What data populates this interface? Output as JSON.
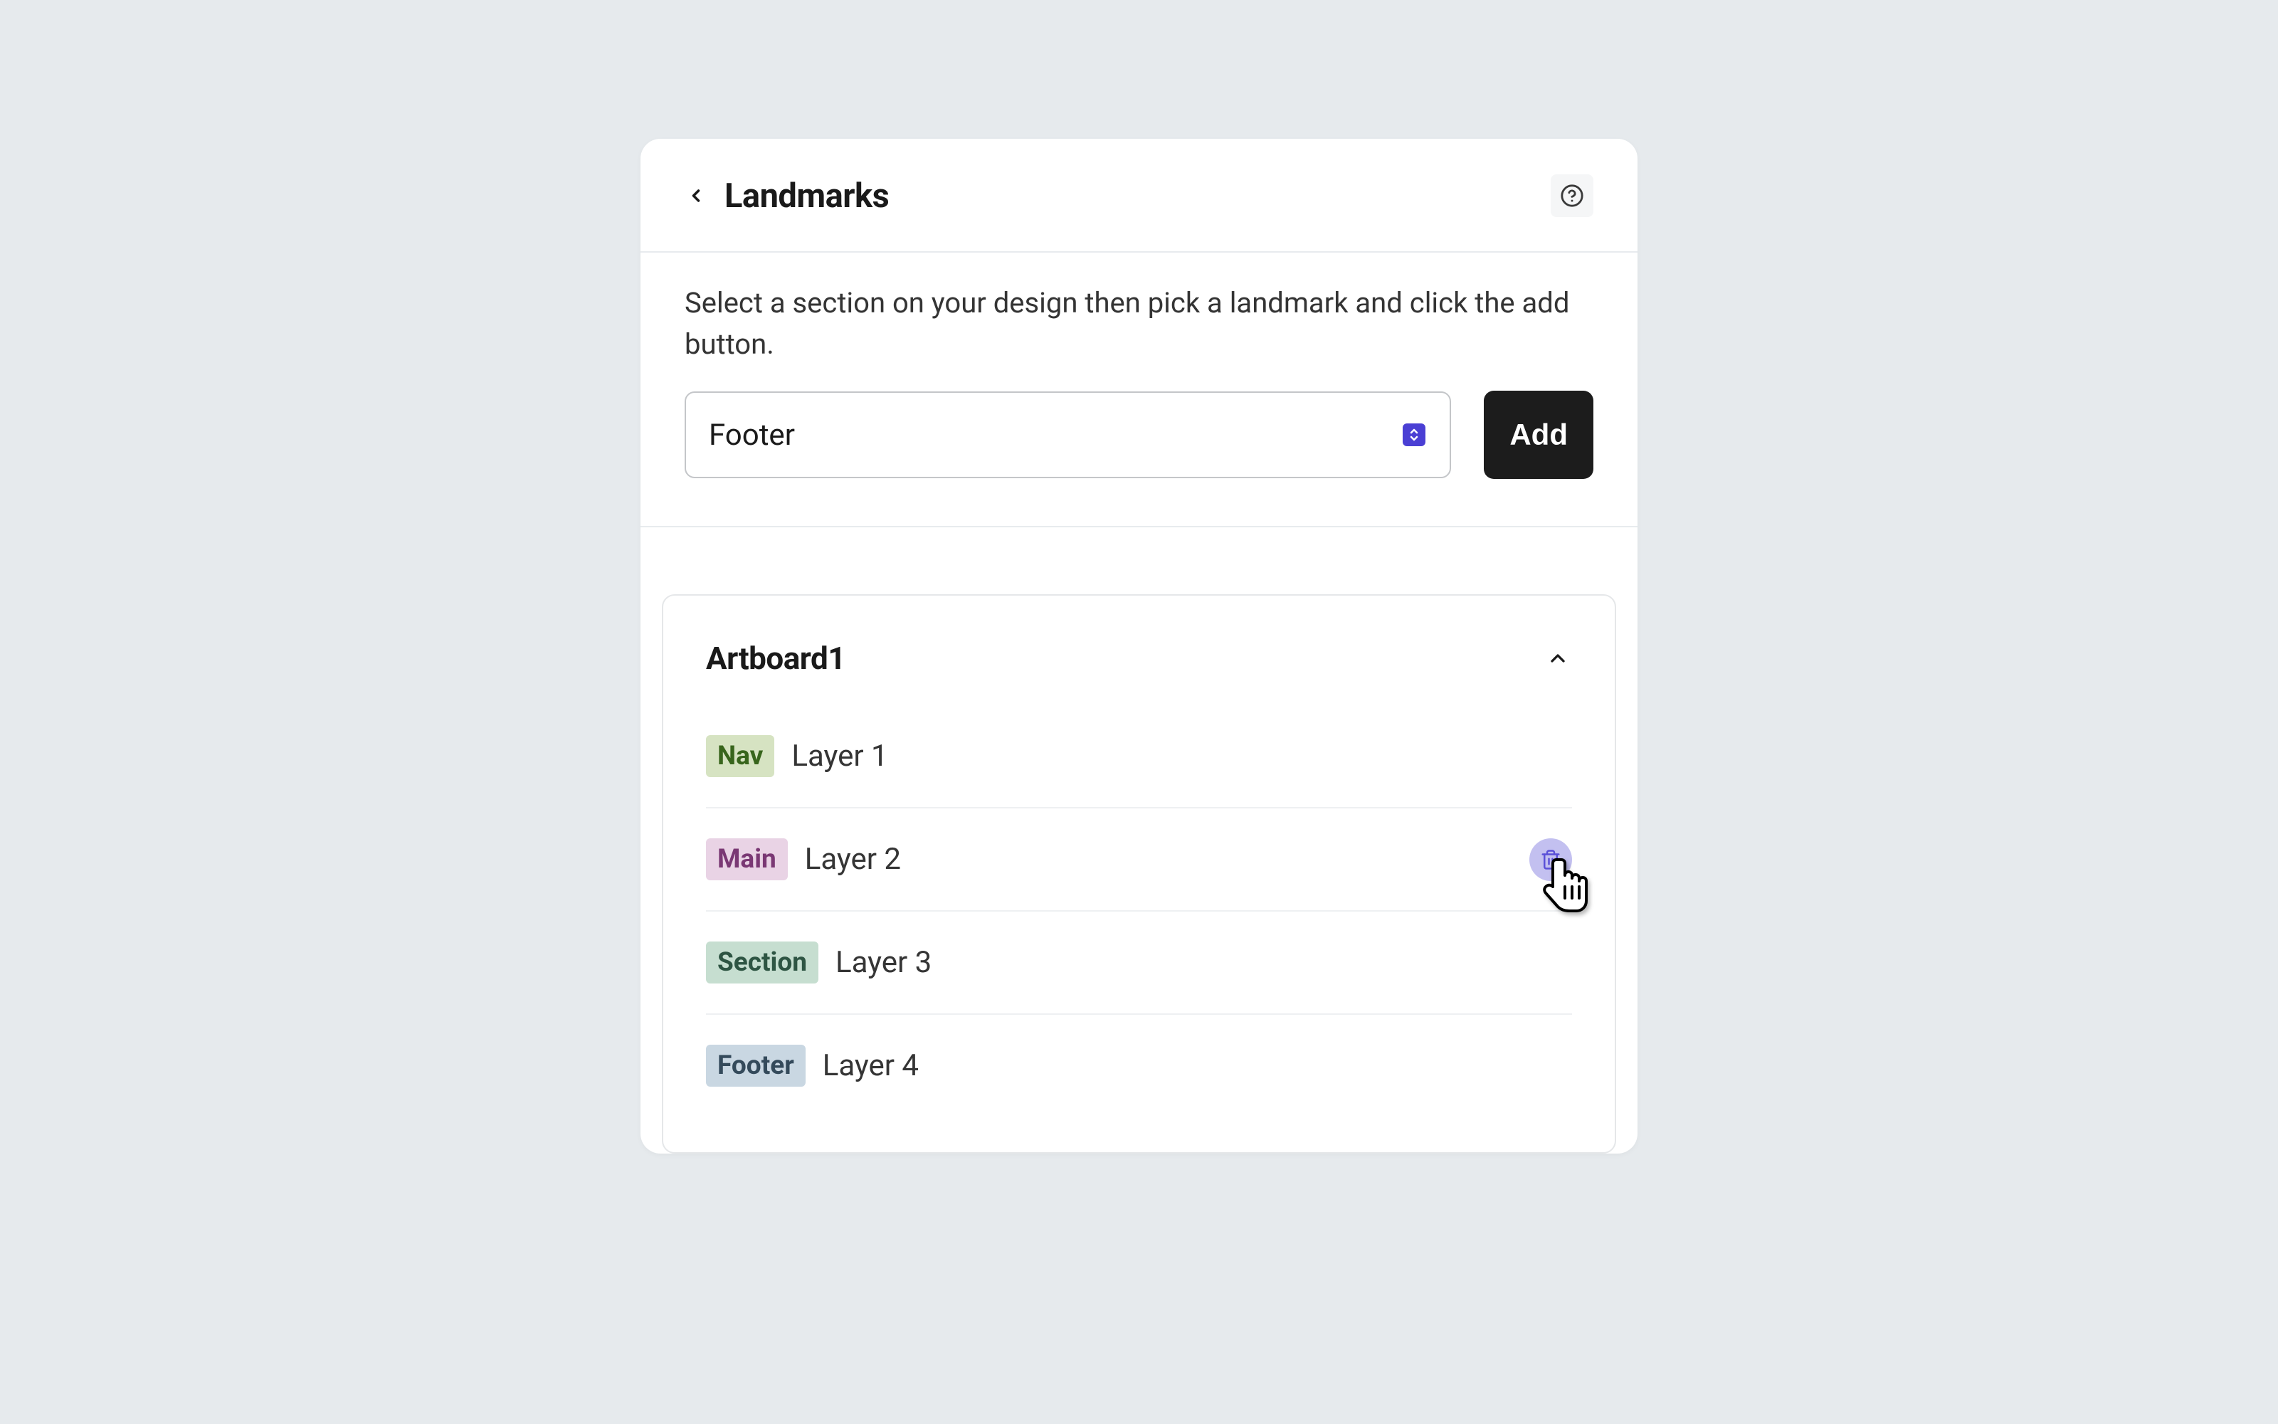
{
  "header": {
    "title": "Landmarks"
  },
  "instructions": "Select a section on your design then pick a landmark and click the add button.",
  "select": {
    "value": "Footer"
  },
  "add_button": "Add",
  "artboard": {
    "title": "Artboard1",
    "layers": [
      {
        "tag": "Nav",
        "tag_class": "tag-nav",
        "label": "Layer 1",
        "show_delete": false
      },
      {
        "tag": "Main",
        "tag_class": "tag-main",
        "label": "Layer 2",
        "show_delete": true
      },
      {
        "tag": "Section",
        "tag_class": "tag-section",
        "label": "Layer 3",
        "show_delete": false
      },
      {
        "tag": "Footer",
        "tag_class": "tag-footer",
        "label": "Layer 4",
        "show_delete": false
      }
    ]
  }
}
